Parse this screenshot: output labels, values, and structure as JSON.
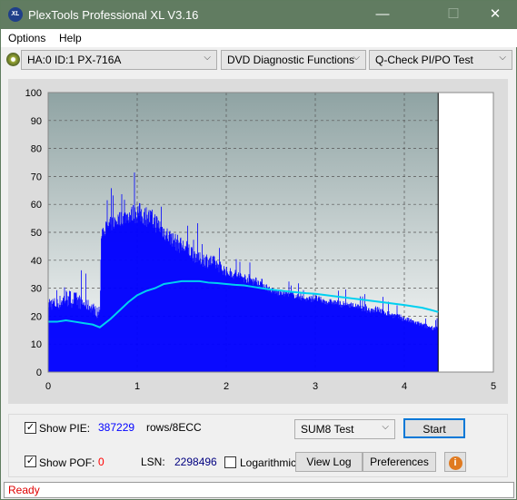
{
  "window": {
    "title": "PlexTools Professional XL V3.16",
    "logo": "XL",
    "minimize": "—",
    "maximize": "☐",
    "close": "✕"
  },
  "menu": {
    "options": "Options",
    "help": "Help"
  },
  "toolbar": {
    "drive": "HA:0 ID:1  PX-716A",
    "function": "DVD Diagnostic Functions",
    "test": "Q-Check PI/PO Test"
  },
  "controls": {
    "show_pie": "Show PIE:",
    "pie_value": "387229",
    "pie_unit": "rows/8ECC",
    "show_pof": "Show POF:",
    "pof_value": "0",
    "lsn_label": "LSN:",
    "lsn_value": "2298496",
    "logarithmic": "Logarithmic",
    "test_mode": "SUM8 Test",
    "start": "Start",
    "view_log": "View Log",
    "preferences": "Preferences",
    "show_pie_checked": true,
    "show_pof_checked": true,
    "logarithmic_checked": false
  },
  "status": "Ready",
  "colors": {
    "pie": "#0000ff",
    "average": "#00d0f0",
    "pof": "#ff0000",
    "titlebar": "#617c61"
  },
  "chart_data": {
    "type": "bar",
    "xlim": [
      0,
      5
    ],
    "ylim": [
      0,
      100
    ],
    "x_ticks": [
      "0",
      "1",
      "2",
      "3",
      "4",
      "5"
    ],
    "y_ticks": [
      "0",
      "10",
      "20",
      "30",
      "40",
      "50",
      "60",
      "70",
      "80",
      "90",
      "100"
    ],
    "grid": true,
    "end_marker_x": 4.38,
    "x": [
      0,
      0.1,
      0.2,
      0.3,
      0.4,
      0.5,
      0.58,
      0.6,
      0.7,
      0.8,
      0.9,
      1.0,
      1.1,
      1.2,
      1.3,
      1.4,
      1.5,
      1.6,
      1.7,
      1.8,
      1.9,
      2.0,
      2.1,
      2.2,
      2.3,
      2.4,
      2.5,
      2.6,
      2.7,
      2.8,
      2.9,
      3.0,
      3.1,
      3.2,
      3.3,
      3.4,
      3.5,
      3.6,
      3.7,
      3.8,
      3.9,
      4.0,
      4.1,
      4.2,
      4.3,
      4.38
    ],
    "pie_max": [
      38,
      35,
      43,
      40,
      36,
      33,
      30,
      62,
      66,
      68,
      70,
      76,
      74,
      72,
      66,
      62,
      60,
      58,
      52,
      54,
      50,
      45,
      44,
      42,
      42,
      40,
      35,
      34,
      33,
      32,
      31,
      33,
      31,
      30,
      30,
      29,
      28,
      28,
      29,
      26,
      25,
      24,
      22,
      21,
      20,
      20
    ],
    "pie_typical": [
      22,
      22,
      23,
      23,
      22,
      21,
      18,
      48,
      50,
      52,
      53,
      53,
      52,
      50,
      47,
      44,
      42,
      40,
      38,
      37,
      36,
      34,
      33,
      32,
      31,
      30,
      28,
      27,
      27,
      26,
      25,
      25,
      24,
      24,
      23,
      23,
      22,
      21,
      21,
      20,
      19,
      18,
      17,
      16,
      15,
      15
    ],
    "average": [
      18,
      18,
      18.5,
      18,
      17.5,
      17,
      16,
      16.5,
      19,
      22,
      25,
      27.5,
      29,
      30,
      31.5,
      32,
      32.5,
      32.5,
      32.5,
      32,
      31.8,
      31.5,
      31.2,
      31,
      30.5,
      30,
      29.5,
      29.2,
      28.8,
      28.5,
      28.2,
      28,
      27.6,
      27.2,
      26.8,
      26.4,
      26,
      25.6,
      25.2,
      24.8,
      24.4,
      24,
      23.5,
      23,
      22.2,
      21.5
    ]
  }
}
